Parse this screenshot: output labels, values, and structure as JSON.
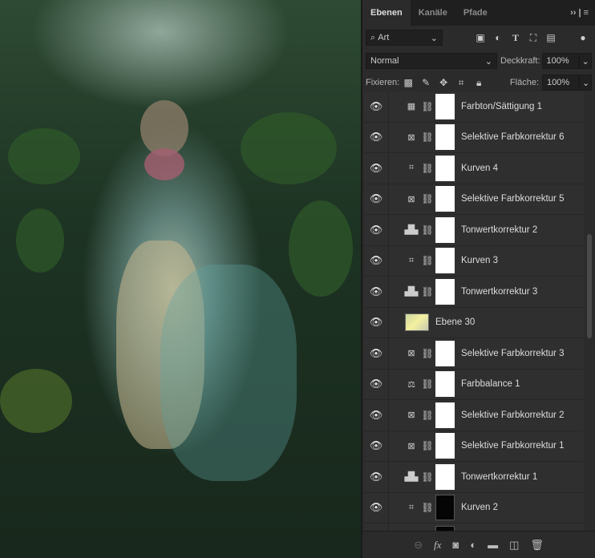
{
  "tabs": [
    "Ebenen",
    "Kanäle",
    "Pfade"
  ],
  "tab_menu": "›› | ≡",
  "filter": {
    "label": "Art"
  },
  "blend_mode": "Normal",
  "opacity": {
    "label": "Deckkraft:",
    "value": "100%"
  },
  "lock": {
    "label": "Fixieren:"
  },
  "fill": {
    "label": "Fläche:",
    "value": "100%"
  },
  "layers": [
    {
      "name": "Farbton/Sättigung 1",
      "icon": "hue-saturation-icon",
      "glyph": "▦"
    },
    {
      "name": "Selektive Farbkorrektur 6",
      "icon": "selective-color-icon",
      "glyph": "⊠"
    },
    {
      "name": "Kurven 4",
      "icon": "curves-icon",
      "glyph": "⌗"
    },
    {
      "name": "Selektive Farbkorrektur 5",
      "icon": "selective-color-icon",
      "glyph": "⊠"
    },
    {
      "name": "Tonwertkorrektur 2",
      "icon": "levels-icon",
      "glyph": "▟▙"
    },
    {
      "name": "Kurven 3",
      "icon": "curves-icon",
      "glyph": "⌗"
    },
    {
      "name": "Tonwertkorrektur 3",
      "icon": "levels-icon",
      "glyph": "▟▙"
    },
    {
      "name": "Ebene 30",
      "icon": "pixel-layer",
      "glyph": ""
    },
    {
      "name": "Selektive Farbkorrektur 3",
      "icon": "selective-color-icon",
      "glyph": "⊠"
    },
    {
      "name": "Farbbalance 1",
      "icon": "color-balance-icon",
      "glyph": "⚖"
    },
    {
      "name": "Selektive Farbkorrektur 2",
      "icon": "selective-color-icon",
      "glyph": "⊠"
    },
    {
      "name": "Selektive Farbkorrektur 1",
      "icon": "selective-color-icon",
      "glyph": "⊠"
    },
    {
      "name": "Tonwertkorrektur 1",
      "icon": "levels-icon",
      "glyph": "▟▙"
    },
    {
      "name": "Kurven 2",
      "icon": "curves-icon",
      "glyph": "⌗"
    },
    {
      "name": "",
      "icon": "curves-icon",
      "glyph": "⌗"
    }
  ]
}
